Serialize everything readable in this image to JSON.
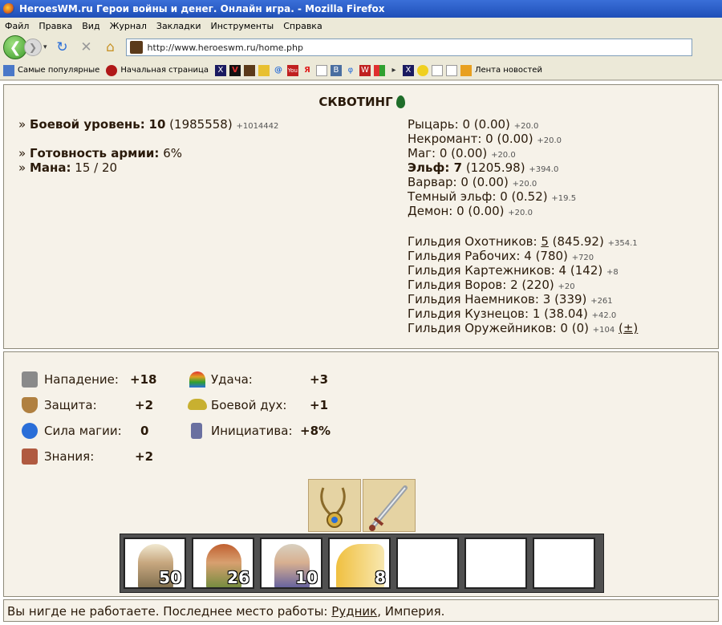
{
  "window": {
    "title": "HeroesWM.ru Герои войны и денег. Онлайн игра. - Mozilla Firefox"
  },
  "menu": [
    "Файл",
    "Правка",
    "Вид",
    "Журнал",
    "Закладки",
    "Инструменты",
    "Справка"
  ],
  "address": {
    "url": "http://www.heroeswm.ru/home.php"
  },
  "bookmarks": {
    "popular": "Самые популярные",
    "home": "Начальная страница",
    "news": "Лента новостей"
  },
  "hero": {
    "name": "СКВОТИНГ",
    "combat_level_label": "Боевой уровень:",
    "combat_level": "10",
    "combat_exp": "(1985558)",
    "combat_gain": "+1014442",
    "army_ready_label": "Готовность армии:",
    "army_ready": "6%",
    "mana_label": "Мана:",
    "mana": "15 / 20"
  },
  "factions": [
    {
      "label": "Рыцарь:",
      "value": "0 (0.00)",
      "gain": "+20.0"
    },
    {
      "label": "Некромант:",
      "value": "0 (0.00)",
      "gain": "+20.0"
    },
    {
      "label": "Маг:",
      "value": "0 (0.00)",
      "gain": "+20.0"
    },
    {
      "label": "Эльф: 7",
      "value": "(1205.98)",
      "gain": "+394.0"
    },
    {
      "label": "Варвар:",
      "value": "0 (0.00)",
      "gain": "+20.0"
    },
    {
      "label": "Темный эльф:",
      "value": "0 (0.52)",
      "gain": "+19.5"
    },
    {
      "label": "Демон:",
      "value": "0 (0.00)",
      "gain": "+20.0"
    }
  ],
  "guilds": [
    {
      "label": "Гильдия Охотников:",
      "level": "5",
      "value": "(845.92)",
      "gain": "+354.1"
    },
    {
      "label": "Гильдия Рабочих:",
      "level": "4",
      "value": "(780)",
      "gain": "+720"
    },
    {
      "label": "Гильдия Картежников:",
      "level": "4",
      "value": "(142)",
      "gain": "+8"
    },
    {
      "label": "Гильдия Воров:",
      "level": "2",
      "value": "(220)",
      "gain": "+20"
    },
    {
      "label": "Гильдия Наемников:",
      "level": "3",
      "value": "(339)",
      "gain": "+261"
    },
    {
      "label": "Гильдия Кузнецов:",
      "level": "1",
      "value": "(38.04)",
      "gain": "+42.0"
    },
    {
      "label": "Гильдия Оружейников:",
      "level": "0",
      "value": "(0)",
      "gain": "+104",
      "extra": "(±)"
    }
  ],
  "stats_left": [
    {
      "label": "Нападение:",
      "value": "+18",
      "icon": "swords-icon",
      "color": "#8a8a8a"
    },
    {
      "label": "Защита:",
      "value": "+2",
      "icon": "shield-icon",
      "color": "#b08040"
    },
    {
      "label": "Сила магии:",
      "value": "0",
      "icon": "magic-wand-icon",
      "color": "#2a6ed8"
    },
    {
      "label": "Знания:",
      "value": "+2",
      "icon": "book-icon",
      "color": "#b05a40"
    }
  ],
  "stats_right": [
    {
      "label": "Удача:",
      "value": "+3",
      "icon": "rainbow-icon",
      "color": "#e0a020"
    },
    {
      "label": "Боевой дух:",
      "value": "+1",
      "icon": "wings-icon",
      "color": "#c8b030"
    },
    {
      "label": "Инициатива:",
      "value": "+8%",
      "icon": "hourglass-icon",
      "color": "#6a70a0"
    }
  ],
  "army": [
    {
      "count": "50",
      "icon": "elf-warrior-icon"
    },
    {
      "count": "26",
      "icon": "elf-druid-icon"
    },
    {
      "count": "10",
      "icon": "elf-mage-icon"
    },
    {
      "count": "8",
      "icon": "unicorn-icon"
    }
  ],
  "work": {
    "prefix": "Вы нигде не работаете. Последнее место работы:",
    "place": "Рудник",
    "suffix": ", Империя."
  }
}
